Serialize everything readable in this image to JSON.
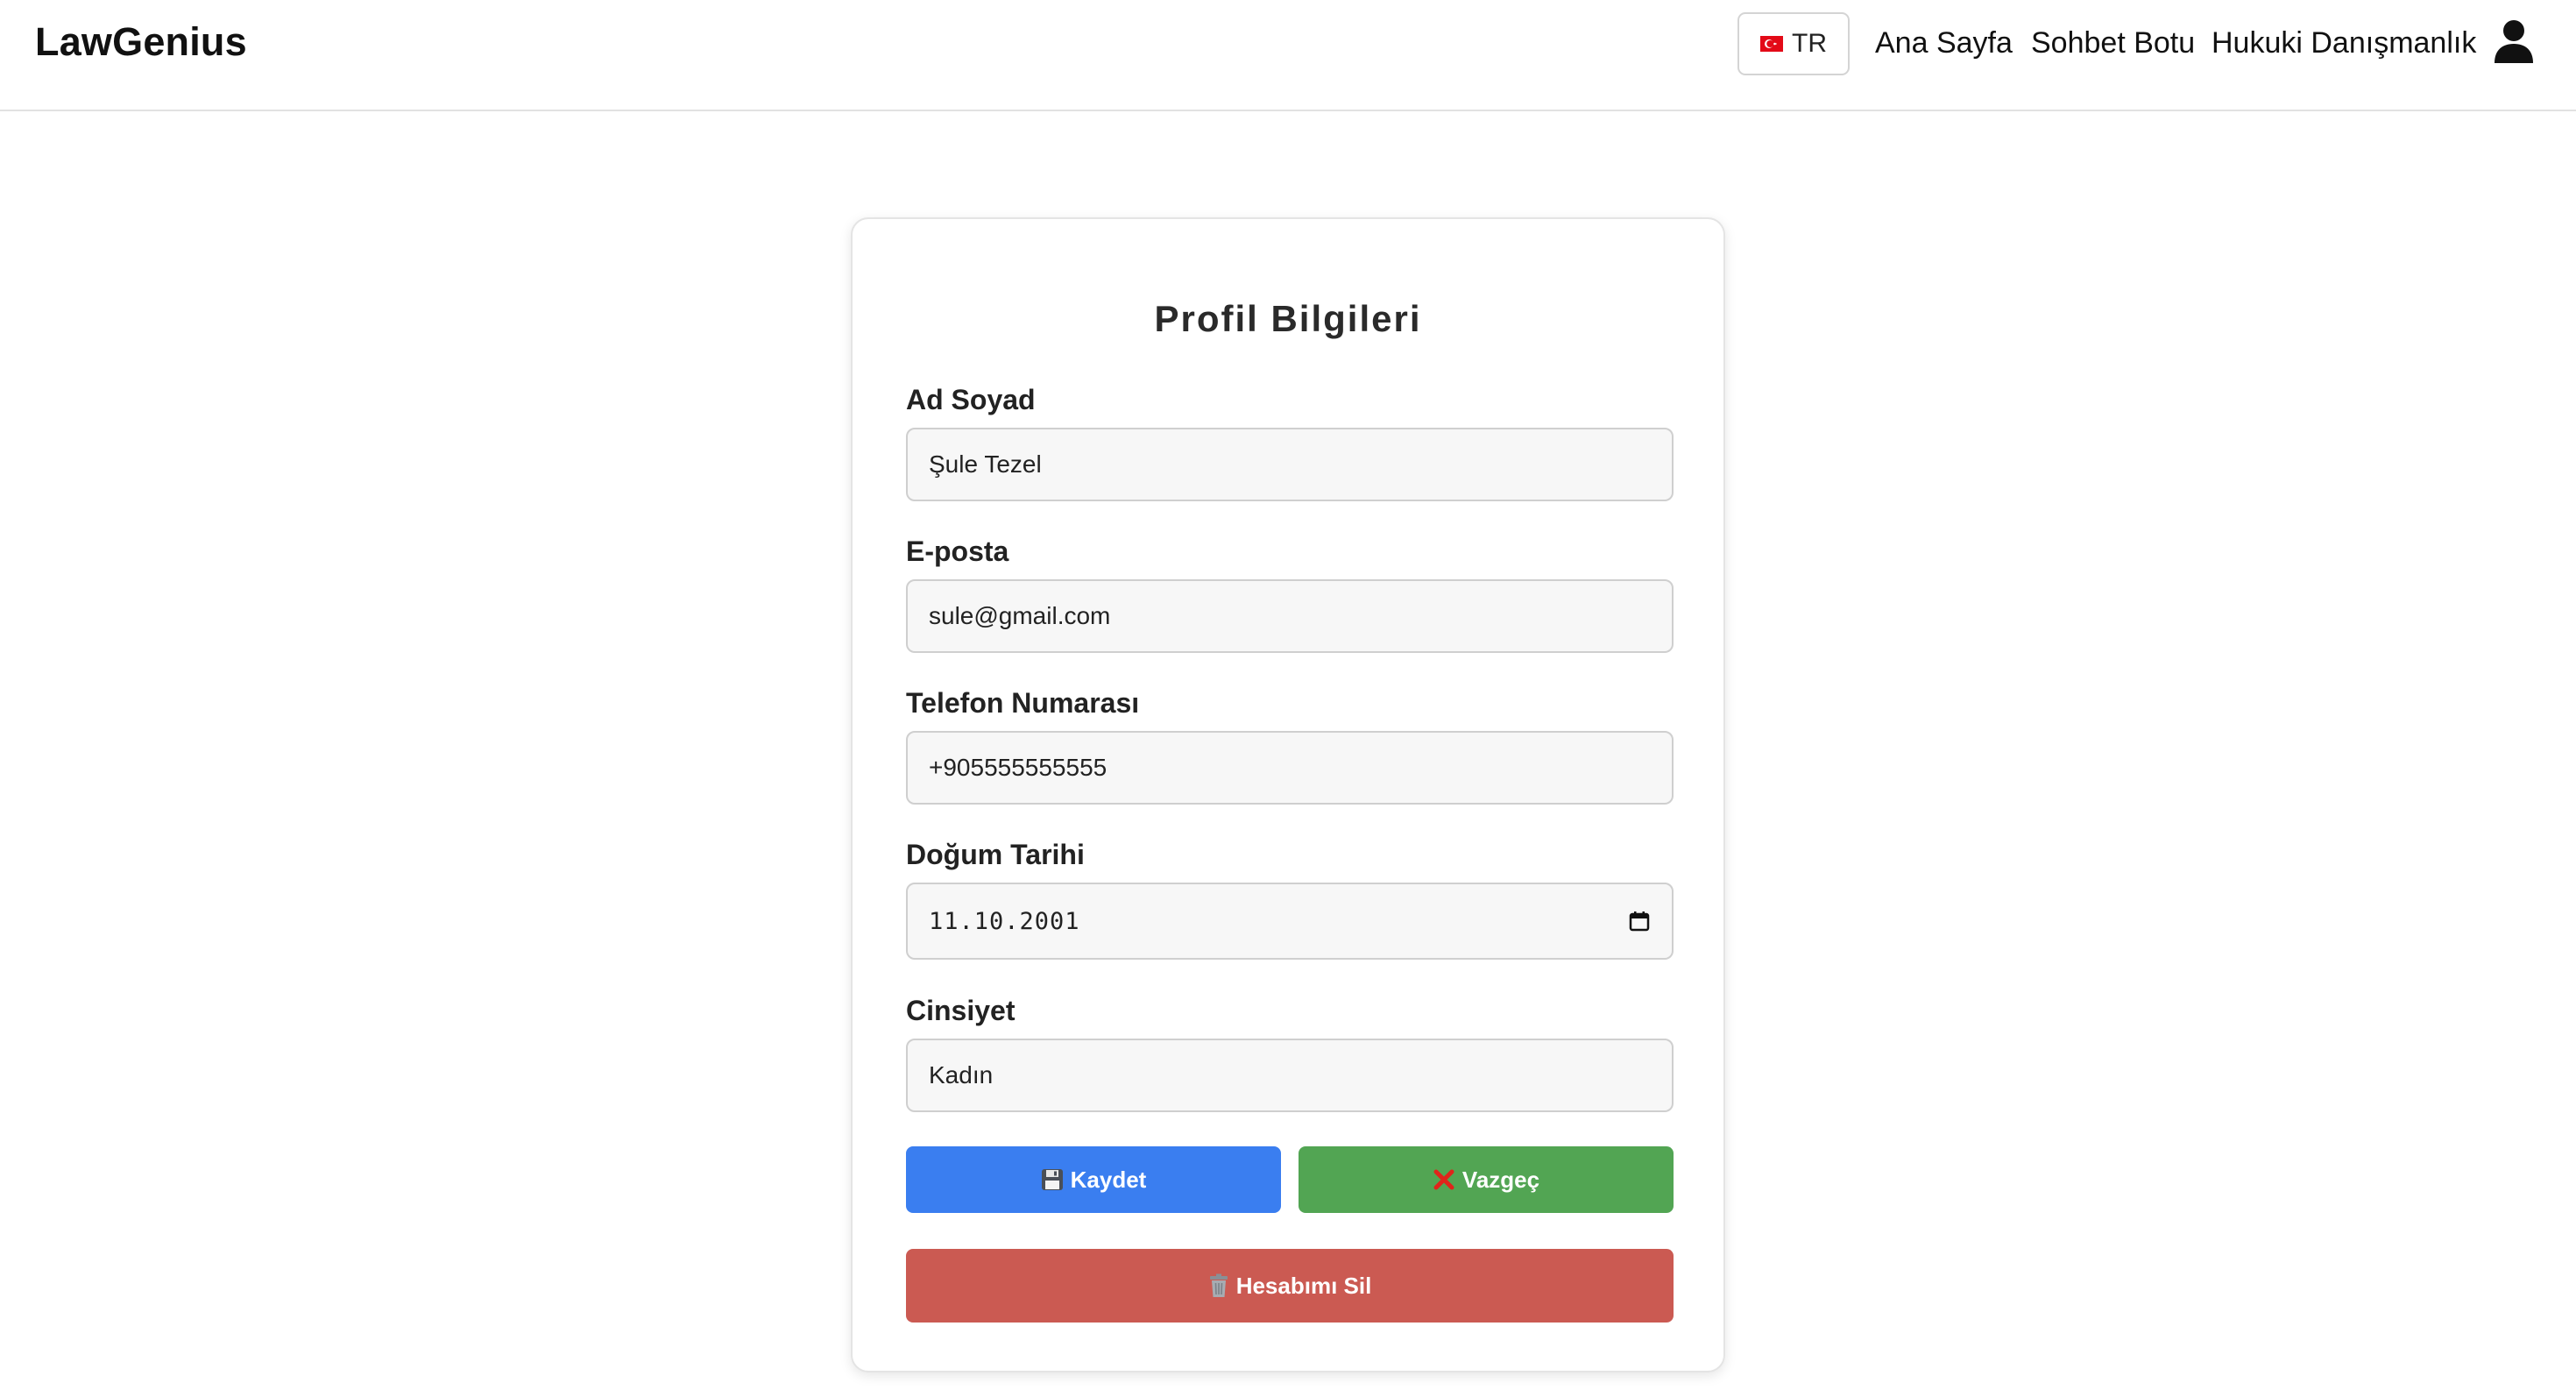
{
  "header": {
    "brand": "LawGenius",
    "language": {
      "code": "TR",
      "flag_icon": "turkey-flag-icon"
    },
    "nav": [
      {
        "label": "Ana Sayfa"
      },
      {
        "label": "Sohbet Botu"
      },
      {
        "label": "Hukuki Danışmanlık"
      }
    ],
    "user_icon": "user-icon"
  },
  "profile": {
    "title": "Profil Bilgileri",
    "fields": [
      {
        "label": "Ad Soyad",
        "value": "Şule Tezel"
      },
      {
        "label": "E-posta",
        "value": "sule@gmail.com"
      },
      {
        "label": "Telefon Numarası",
        "value": "+905555555555"
      },
      {
        "label": "Doğum Tarihi",
        "value": "11.10.2001"
      },
      {
        "label": "Cinsiyet",
        "value": "Kadın"
      }
    ],
    "buttons": {
      "save": {
        "label": "Kaydet",
        "icon": "floppy-disk-icon"
      },
      "cancel": {
        "label": "Vazgeç",
        "icon": "cross-mark-icon"
      },
      "delete": {
        "label": "Hesabımı Sil",
        "icon": "trash-icon"
      }
    }
  },
  "colors": {
    "save": "#3a7ef0",
    "cancel": "#52a553",
    "delete": "#cb5a52",
    "input_bg": "#f7f7f7"
  }
}
